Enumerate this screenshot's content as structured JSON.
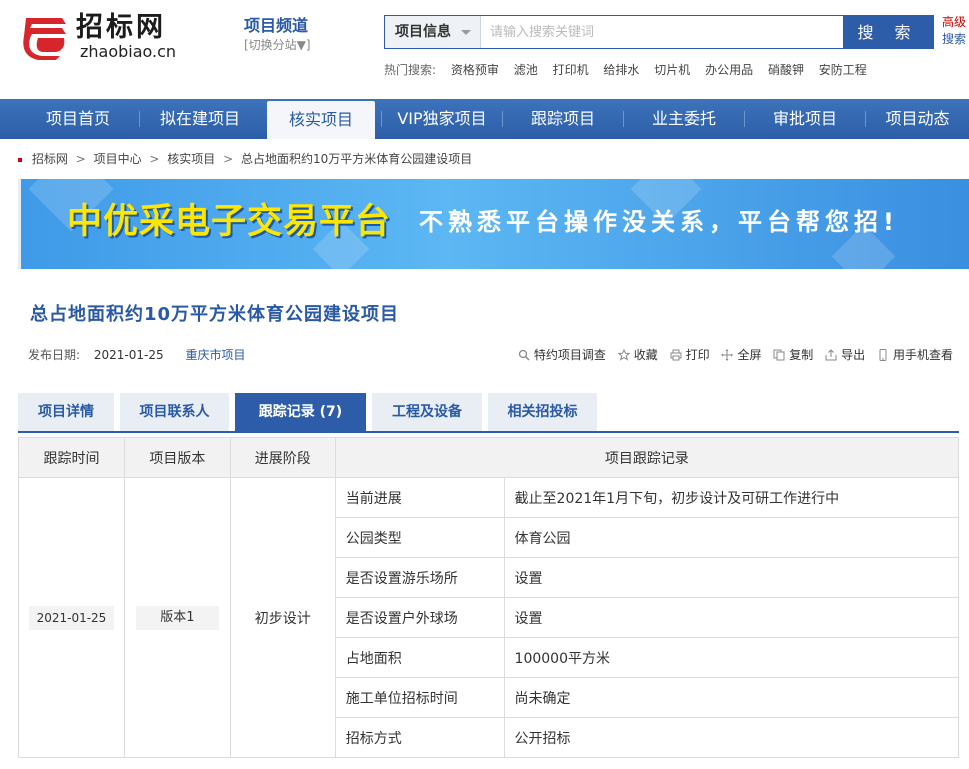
{
  "header": {
    "logo_cn": "招标网",
    "logo_en": "zhaobiao.cn",
    "channel_title": "项目频道",
    "channel_switch": "[切换分站▼]",
    "search_category": "项目信息",
    "search_placeholder": "请输入搜索关键词",
    "search_button": "搜 索",
    "advanced_line1": "高级",
    "advanced_line2": "搜索"
  },
  "hot": {
    "label": "热门搜索:",
    "items": [
      "资格预审",
      "滤池",
      "打印机",
      "给排水",
      "切片机",
      "办公用品",
      "硝酸钾",
      "安防工程"
    ]
  },
  "nav": {
    "items": [
      "项目首页",
      "拟在建项目",
      "核实项目",
      "VIP独家项目",
      "跟踪项目",
      "业主委托",
      "审批项目",
      "项目动态"
    ],
    "active_index": 2
  },
  "breadcrumb": [
    "招标网",
    "项目中心",
    "核实项目",
    "总占地面积约10万平方米体育公园建设项目"
  ],
  "banner": {
    "title": "中优采电子交易平台",
    "subtitle": "不熟悉平台操作没关系，平台帮您招!"
  },
  "project": {
    "title": "总占地面积约10万平方米体育公园建设项目",
    "date_label": "发布日期:",
    "date": "2021-01-25",
    "region": "重庆市项目"
  },
  "actions": [
    "特约项目调查",
    "收藏",
    "打印",
    "全屏",
    "复制",
    "导出",
    "用手机查看"
  ],
  "tabs": {
    "items": [
      "项目详情",
      "项目联系人",
      "跟踪记录 (7)",
      "工程及设备",
      "相关招投标"
    ],
    "active_index": 2
  },
  "table": {
    "headers": [
      "跟踪时间",
      "项目版本",
      "进展阶段",
      "项目跟踪记录"
    ],
    "time": "2021-01-25",
    "version": "版本1",
    "stage": "初步设计",
    "records": [
      {
        "key": "当前进展",
        "value": "截止至2021年1月下旬，初步设计及可研工作进行中"
      },
      {
        "key": "公园类型",
        "value": "体育公园"
      },
      {
        "key": "是否设置游乐场所",
        "value": "设置"
      },
      {
        "key": "是否设置户外球场",
        "value": "设置"
      },
      {
        "key": "占地面积",
        "value": "100000平方米"
      },
      {
        "key": "施工单位招标时间",
        "value": "尚未确定"
      },
      {
        "key": "招标方式",
        "value": "公开招标"
      }
    ]
  },
  "colors": {
    "brand_blue": "#2d5da8",
    "brand_red": "#d7262b",
    "banner_yellow": "#ffe600"
  }
}
